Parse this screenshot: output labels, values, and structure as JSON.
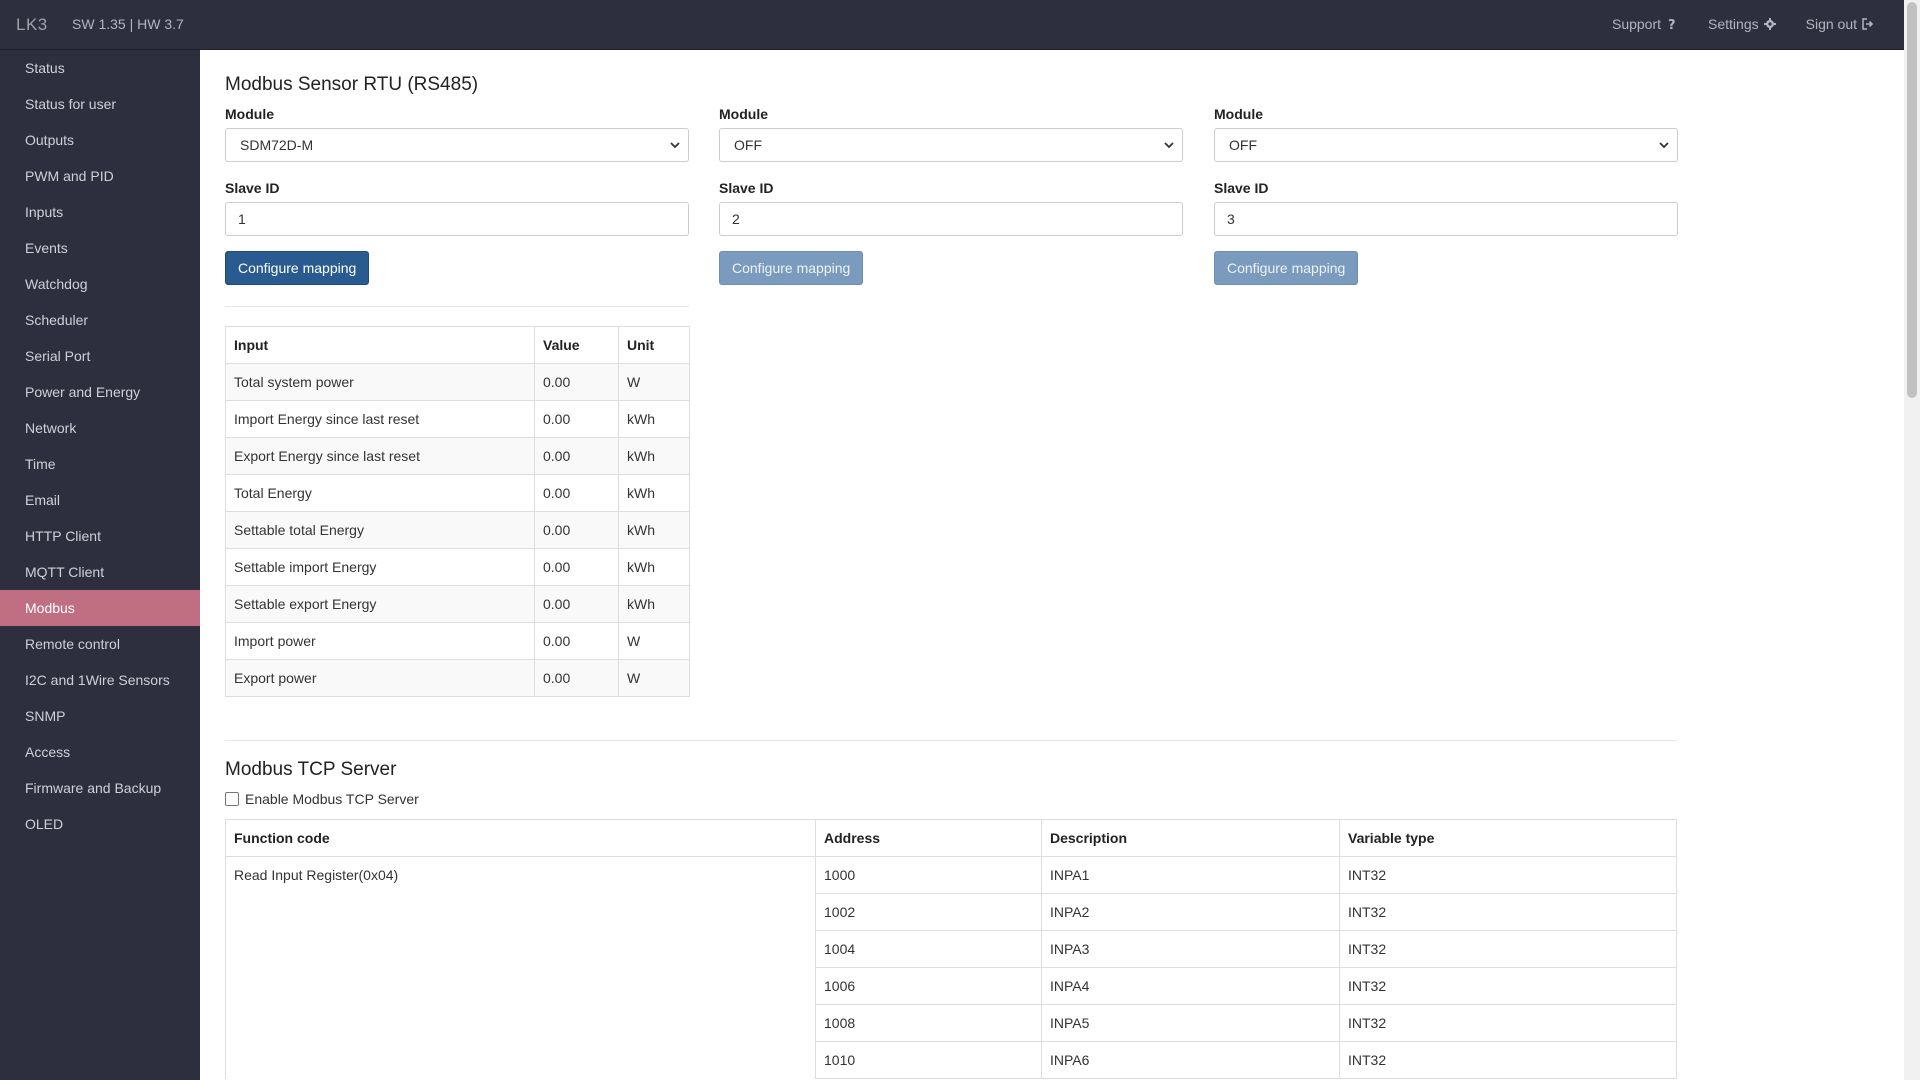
{
  "navbar": {
    "brand": "LK3",
    "version": "SW 1.35 | HW 3.7",
    "support": "Support",
    "settings": "Settings",
    "signout": "Sign out"
  },
  "sidebar": {
    "items": [
      "Status",
      "Status for user",
      "Outputs",
      "PWM and PID",
      "Inputs",
      "Events",
      "Watchdog",
      "Scheduler",
      "Serial Port",
      "Power and Energy",
      "Network",
      "Time",
      "Email",
      "HTTP Client",
      "MQTT Client",
      "Modbus",
      "Remote control",
      "I2C and 1Wire Sensors",
      "SNMP",
      "Access",
      "Firmware and Backup",
      "OLED"
    ],
    "active": "Modbus"
  },
  "rtu": {
    "title": "Modbus Sensor RTU (RS485)",
    "module_label": "Module",
    "slave_label": "Slave ID",
    "button_label": "Configure mapping",
    "columns": [
      {
        "module": "SDM72D-M",
        "slave_id": "1"
      },
      {
        "module": "OFF",
        "slave_id": "2"
      },
      {
        "module": "OFF",
        "slave_id": "3"
      }
    ],
    "table": {
      "headers": [
        "Input",
        "Value",
        "Unit"
      ],
      "rows": [
        [
          "Total system power",
          "0.00",
          "W"
        ],
        [
          "Import Energy since last reset",
          "0.00",
          "kWh"
        ],
        [
          "Export Energy since last reset",
          "0.00",
          "kWh"
        ],
        [
          "Total Energy",
          "0.00",
          "kWh"
        ],
        [
          "Settable total Energy",
          "0.00",
          "kWh"
        ],
        [
          "Settable import Energy",
          "0.00",
          "kWh"
        ],
        [
          "Settable export Energy",
          "0.00",
          "kWh"
        ],
        [
          "Import power",
          "0.00",
          "W"
        ],
        [
          "Export power",
          "0.00",
          "W"
        ]
      ]
    }
  },
  "tcp": {
    "title": "Modbus TCP Server",
    "enable_label": "Enable Modbus TCP Server",
    "table": {
      "headers": [
        "Function code",
        "Address",
        "Description",
        "Variable type"
      ],
      "function": "Read Input Register(0x04)",
      "rows": [
        [
          "1000",
          "INPA1",
          "INT32"
        ],
        [
          "1002",
          "INPA2",
          "INT32"
        ],
        [
          "1004",
          "INPA3",
          "INT32"
        ],
        [
          "1006",
          "INPA4",
          "INT32"
        ],
        [
          "1008",
          "INPA5",
          "INT32"
        ],
        [
          "1010",
          "INPA6",
          "INT32"
        ]
      ]
    }
  },
  "colors": {
    "navbar": "#2e2f3e",
    "sidebar_active": "#c06e82",
    "primary_button": "#2a5b90",
    "disabled_button": "#7a9bbd"
  }
}
